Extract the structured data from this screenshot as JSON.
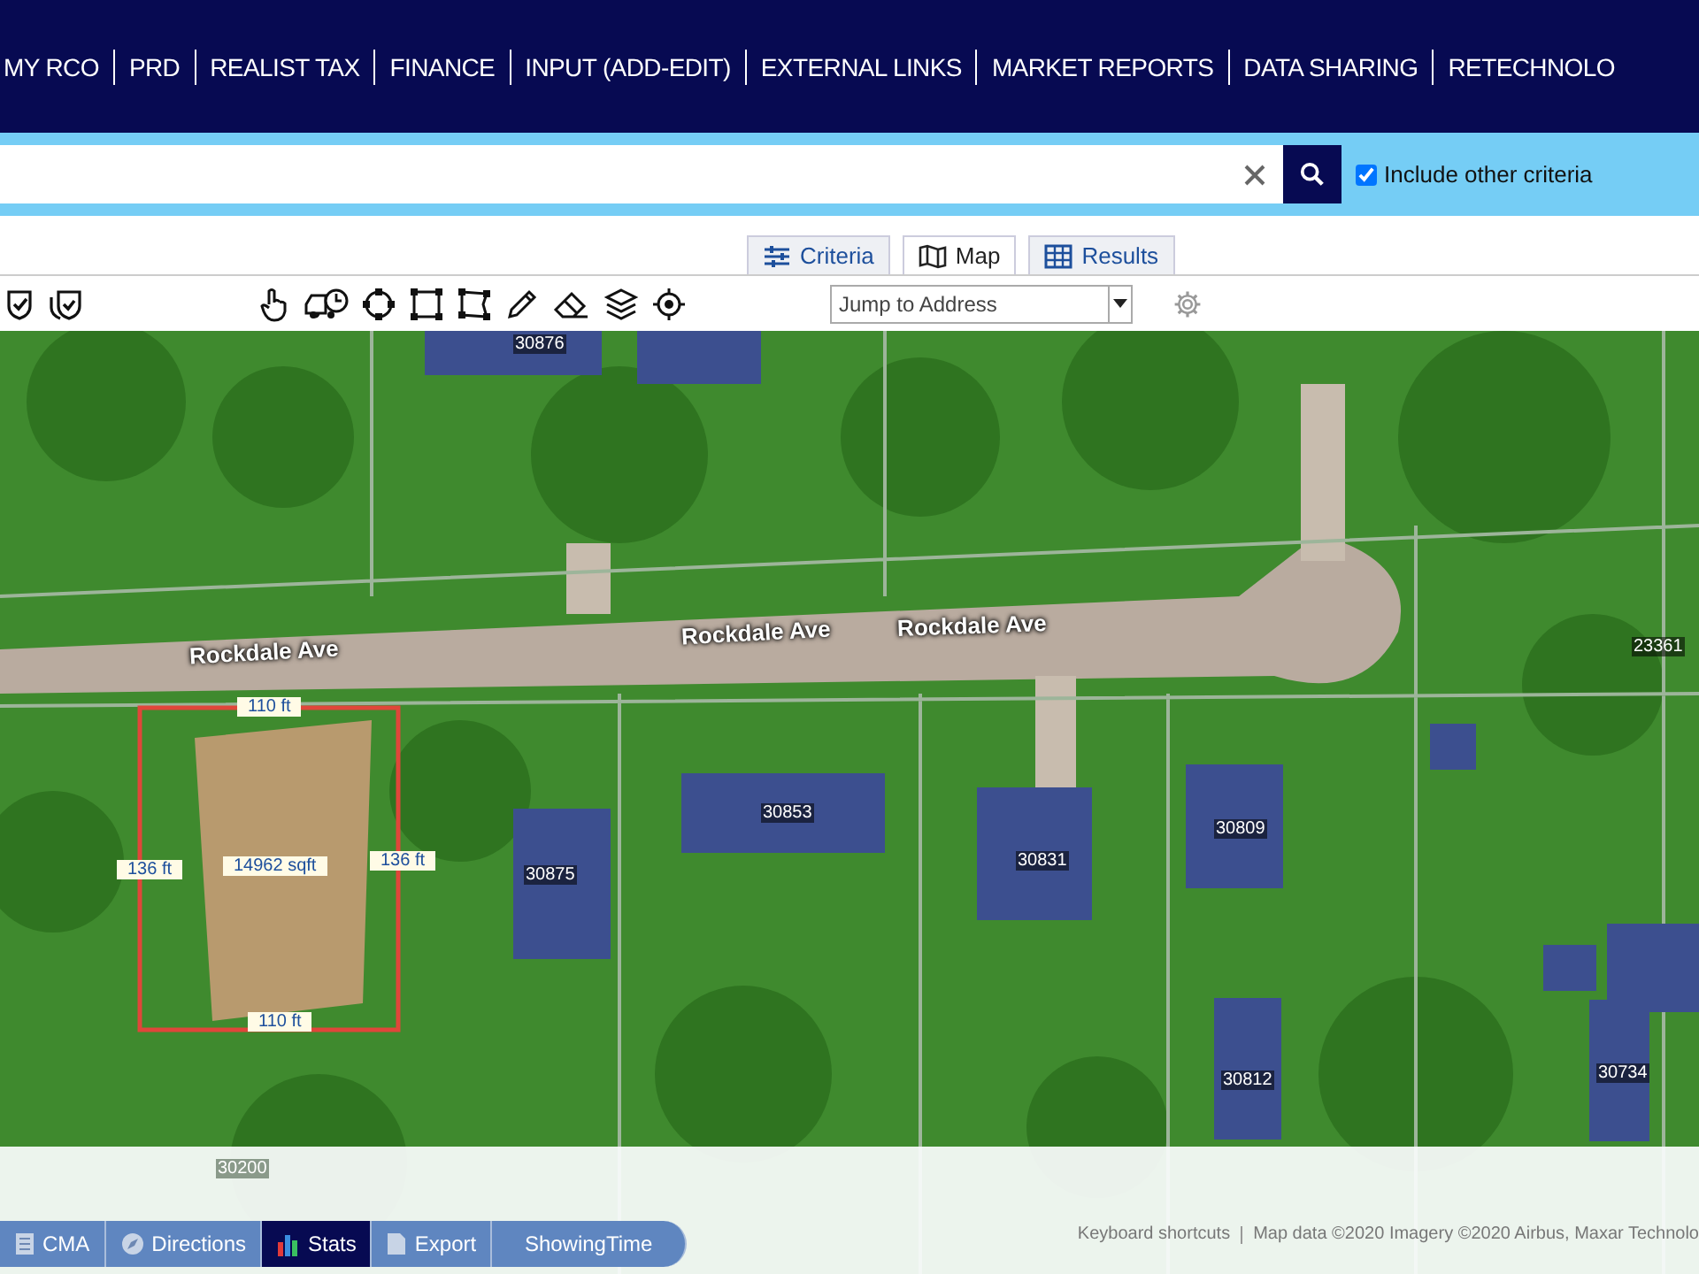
{
  "nav": {
    "items": [
      "MY RCO",
      "PRD",
      "REALIST TAX",
      "FINANCE",
      "INPUT (ADD-EDIT)",
      "EXTERNAL LINKS",
      "MARKET REPORTS",
      "DATA SHARING",
      "RETECHNOLO"
    ]
  },
  "search": {
    "include_other_criteria": {
      "label": "Include other criteria",
      "checked": true
    }
  },
  "view_tabs": [
    {
      "label": "Criteria",
      "selected": false
    },
    {
      "label": "Map",
      "selected": true
    },
    {
      "label": "Results",
      "selected": false
    }
  ],
  "toolbar": {
    "jump_to_address": {
      "placeholder": "Jump to Address"
    }
  },
  "map": {
    "streets": [
      "Rockdale Ave",
      "Rockdale Ave",
      "Rockdale Ave"
    ],
    "house_numbers": [
      "30876",
      "23361",
      "30853",
      "30875",
      "30831",
      "30809",
      "30812",
      "30734",
      "30200"
    ],
    "parcel": {
      "top": "110 ft",
      "left": "136 ft",
      "area": "14962 sqft",
      "right": "136 ft",
      "bottom": "110 ft"
    },
    "attribution": [
      "Keyboard shortcuts",
      "Map data ©2020 Imagery ©2020 Airbus, Maxar Technolo"
    ]
  },
  "bottom_tabs": [
    {
      "label": "CMA",
      "selected": false
    },
    {
      "label": "Directions",
      "selected": false
    },
    {
      "label": "Stats",
      "selected": true
    },
    {
      "label": "Export",
      "selected": false
    },
    {
      "label": "ShowingTime",
      "selected": false
    }
  ]
}
